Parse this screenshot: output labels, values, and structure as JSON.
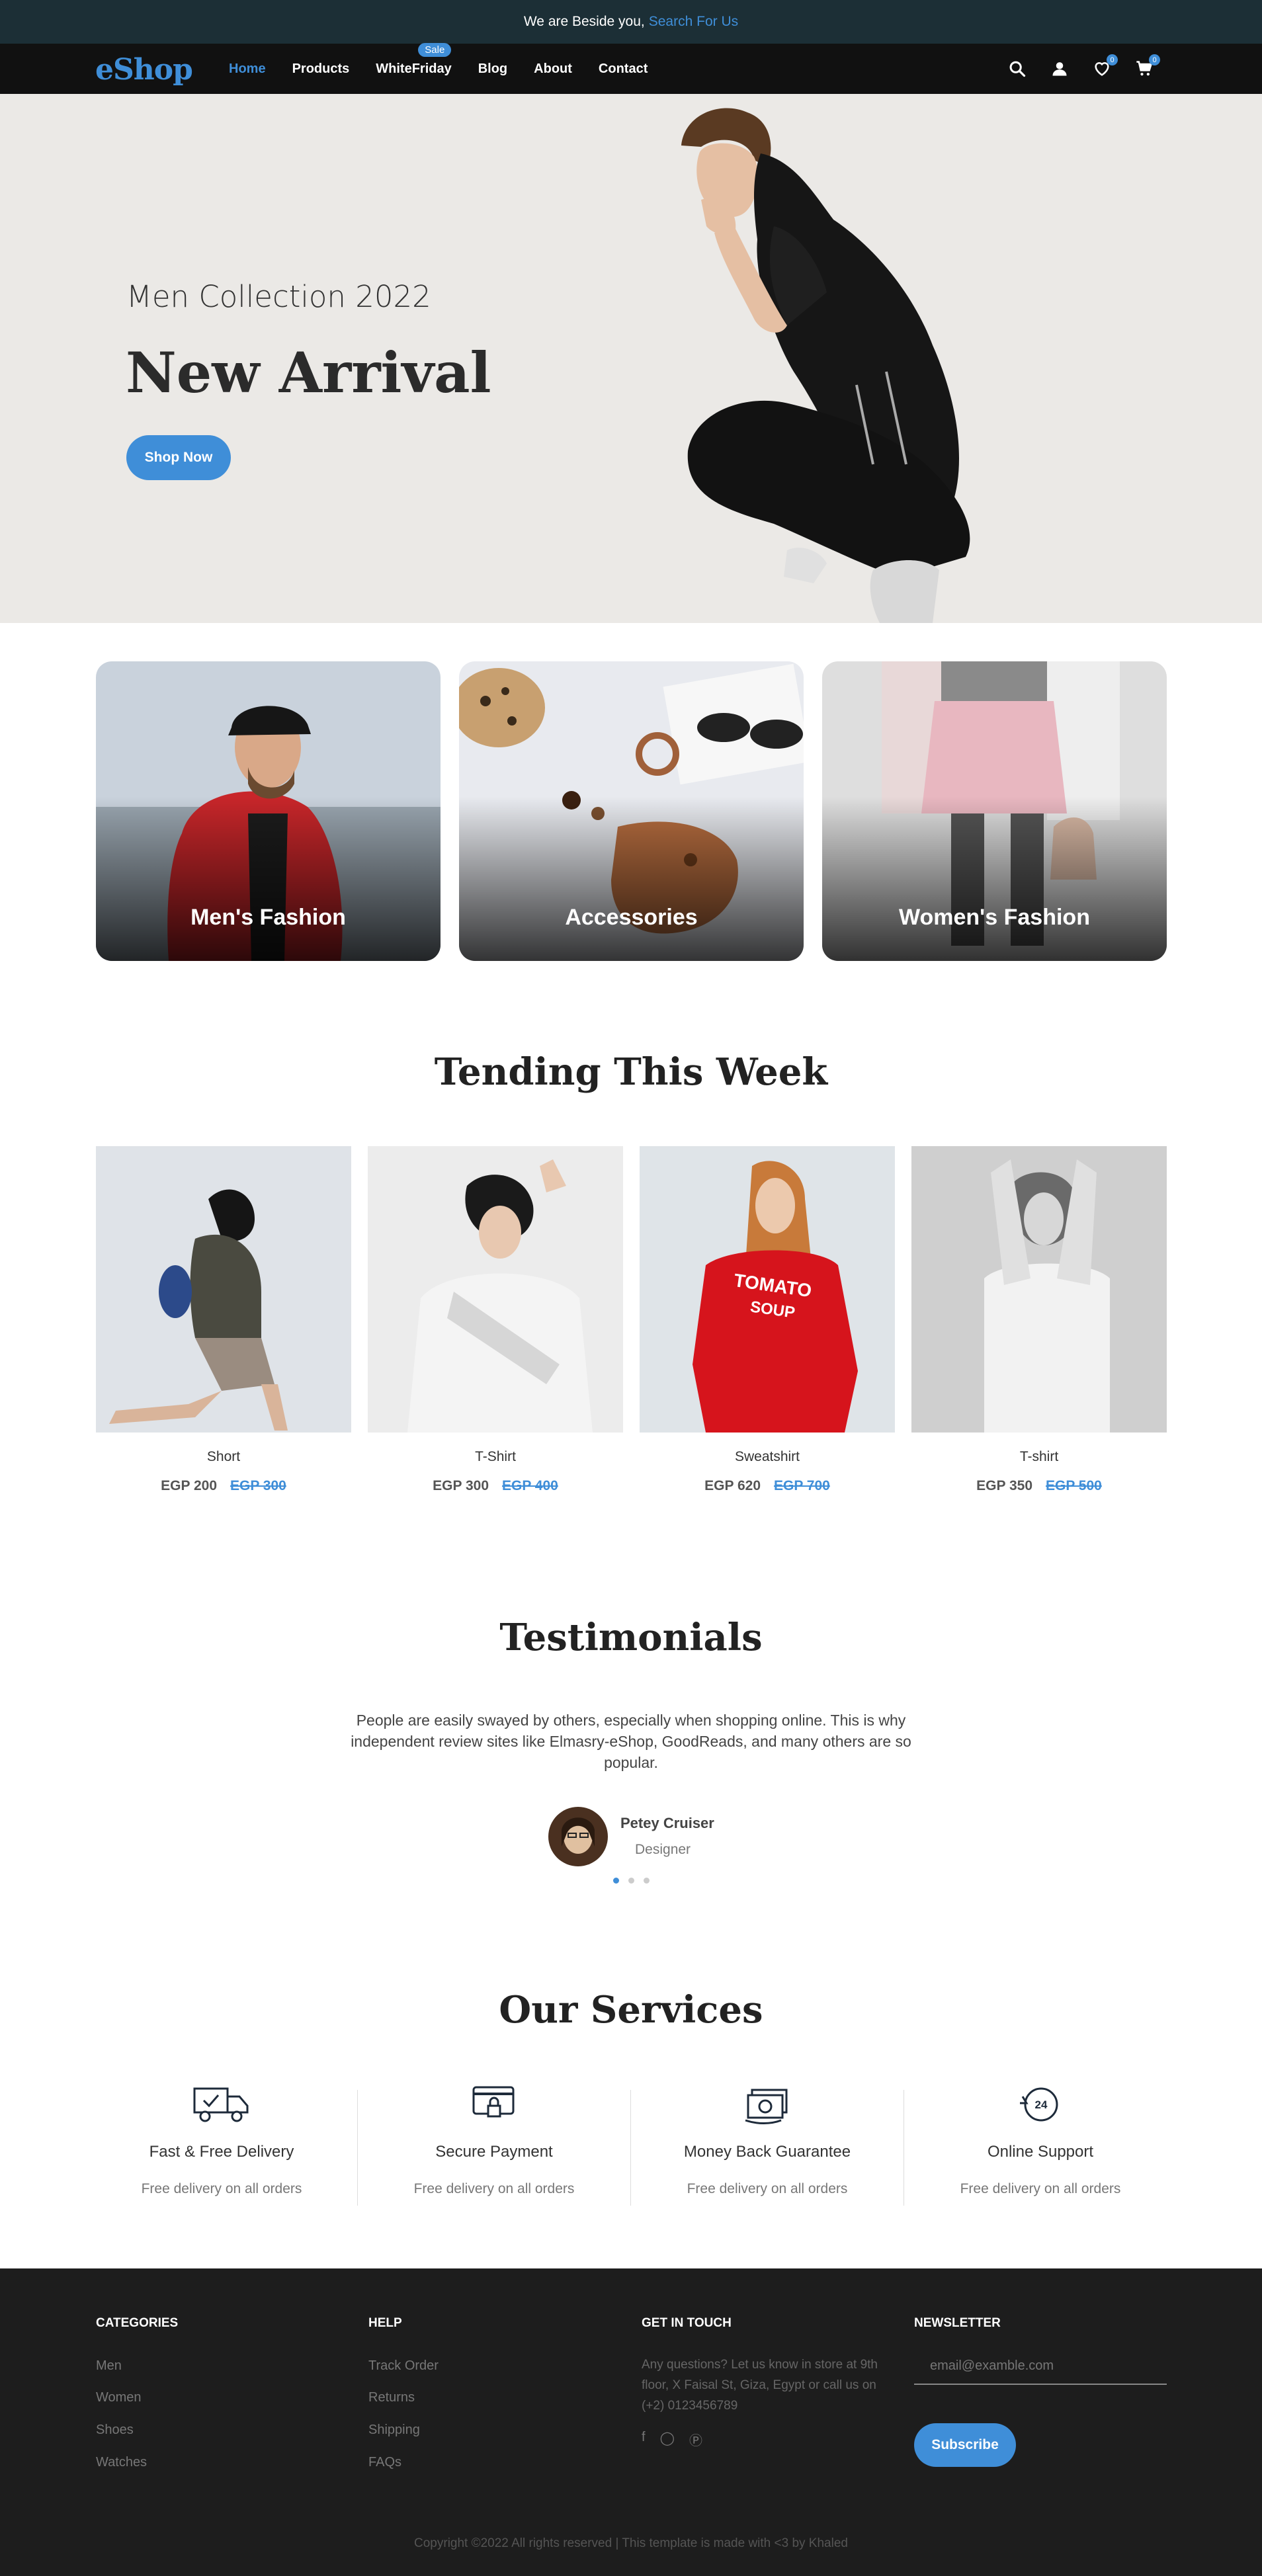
{
  "announcement": {
    "text": "We are Beside you,",
    "link": "Search For Us"
  },
  "brand": {
    "first": "e",
    "rest": "Shop"
  },
  "nav": {
    "items": [
      "Home",
      "Products",
      "WhiteFriday",
      "Blog",
      "About",
      "Contact"
    ],
    "sale_badge": "Sale",
    "wishlist_count": "0",
    "cart_count": "0"
  },
  "hero": {
    "subtitle": "Men Collection 2022",
    "title": "New Arrival",
    "button": "Shop Now"
  },
  "categories": [
    "Men's Fashion",
    "Accessories",
    "Women's Fashion"
  ],
  "trending": {
    "title": "Tending This Week",
    "products": [
      {
        "name": "Short",
        "price": "EGP 200",
        "old_price": "EGP 300"
      },
      {
        "name": "T-Shirt",
        "price": "EGP 300",
        "old_price": "EGP 400"
      },
      {
        "name": "Sweatshirt",
        "price": "EGP 620",
        "old_price": "EGP 700"
      },
      {
        "name": "T-shirt",
        "price": "EGP 350",
        "old_price": "EGP 500"
      }
    ]
  },
  "testimonials": {
    "title": "Testimonials",
    "quote": "People are easily swayed by others, especially when shopping online. This is why independent review sites like Elmasry-eShop, GoodReads, and many others are so popular.",
    "name": "Petey Cruiser",
    "role": "Designer"
  },
  "services": {
    "title": "Our Services",
    "items": [
      {
        "name": "Fast & Free Delivery",
        "desc": "Free delivery on all orders",
        "icon": "delivery-truck-icon"
      },
      {
        "name": "Secure Payment",
        "desc": "Free delivery on all orders",
        "icon": "secure-card-icon"
      },
      {
        "name": "Money Back Guarantee",
        "desc": "Free delivery on all orders",
        "icon": "money-back-icon"
      },
      {
        "name": "Online Support",
        "desc": "Free delivery on all orders",
        "icon": "support-24-icon"
      }
    ]
  },
  "footer": {
    "categories": {
      "title": "CATEGORIES",
      "links": [
        "Men",
        "Women",
        "Shoes",
        "Watches"
      ]
    },
    "help": {
      "title": "HELP",
      "links": [
        "Track Order",
        "Returns",
        "Shipping",
        "FAQs"
      ]
    },
    "contact": {
      "title": "GET IN TOUCH",
      "text": "Any questions? Let us know in store at 9th floor, X Faisal St, Giza, Egypt or call us on (+2) 0123456789"
    },
    "newsletter": {
      "title": "NEWSLETTER",
      "placeholder": "email@examble.com",
      "button": "Subscribe"
    },
    "copyright": "Copyright ©2022 All rights reserved | This template is made with <3 by Khaled"
  },
  "colors": {
    "accent": "#3f8ed8",
    "topbar": "#1c2f36",
    "nav": "#111111",
    "footer": "#1d1d1d"
  }
}
